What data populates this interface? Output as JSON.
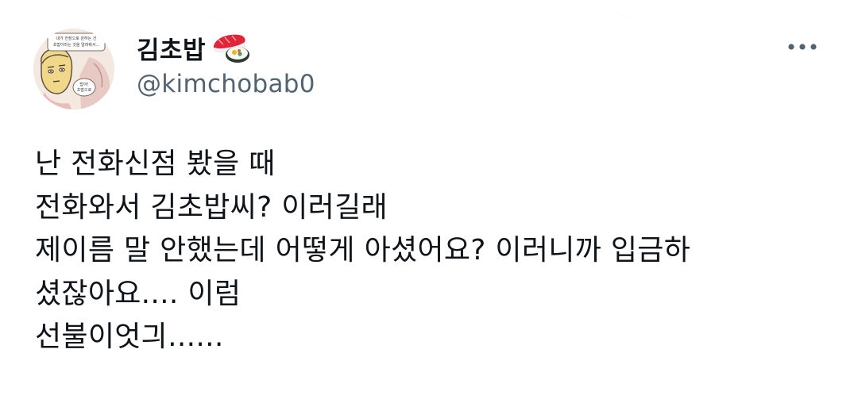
{
  "author": {
    "display_name": "김초밥",
    "handle": "@kimchobab0",
    "name_emoji": "sushi-icon",
    "avatar": {
      "speech_top": "내가 전장으로 원하는 건 초밥이라는 것을 알려줘서...",
      "speech_bottom": "밥아! 초밥으로"
    }
  },
  "more_button": {
    "icon": "more-horizontal-icon"
  },
  "tweet": {
    "lines": [
      "난 전화신점 봤을 때",
      "전화와서 김초밥씨? 이러길래",
      "제이름 말 안했는데 어떻게 아셨어요? 이러니까 입금하",
      "셨잖아요.... 이럼",
      "선불이엇긔......"
    ]
  },
  "colors": {
    "text_primary": "#0f1419",
    "text_secondary": "#536471",
    "background": "#ffffff"
  }
}
